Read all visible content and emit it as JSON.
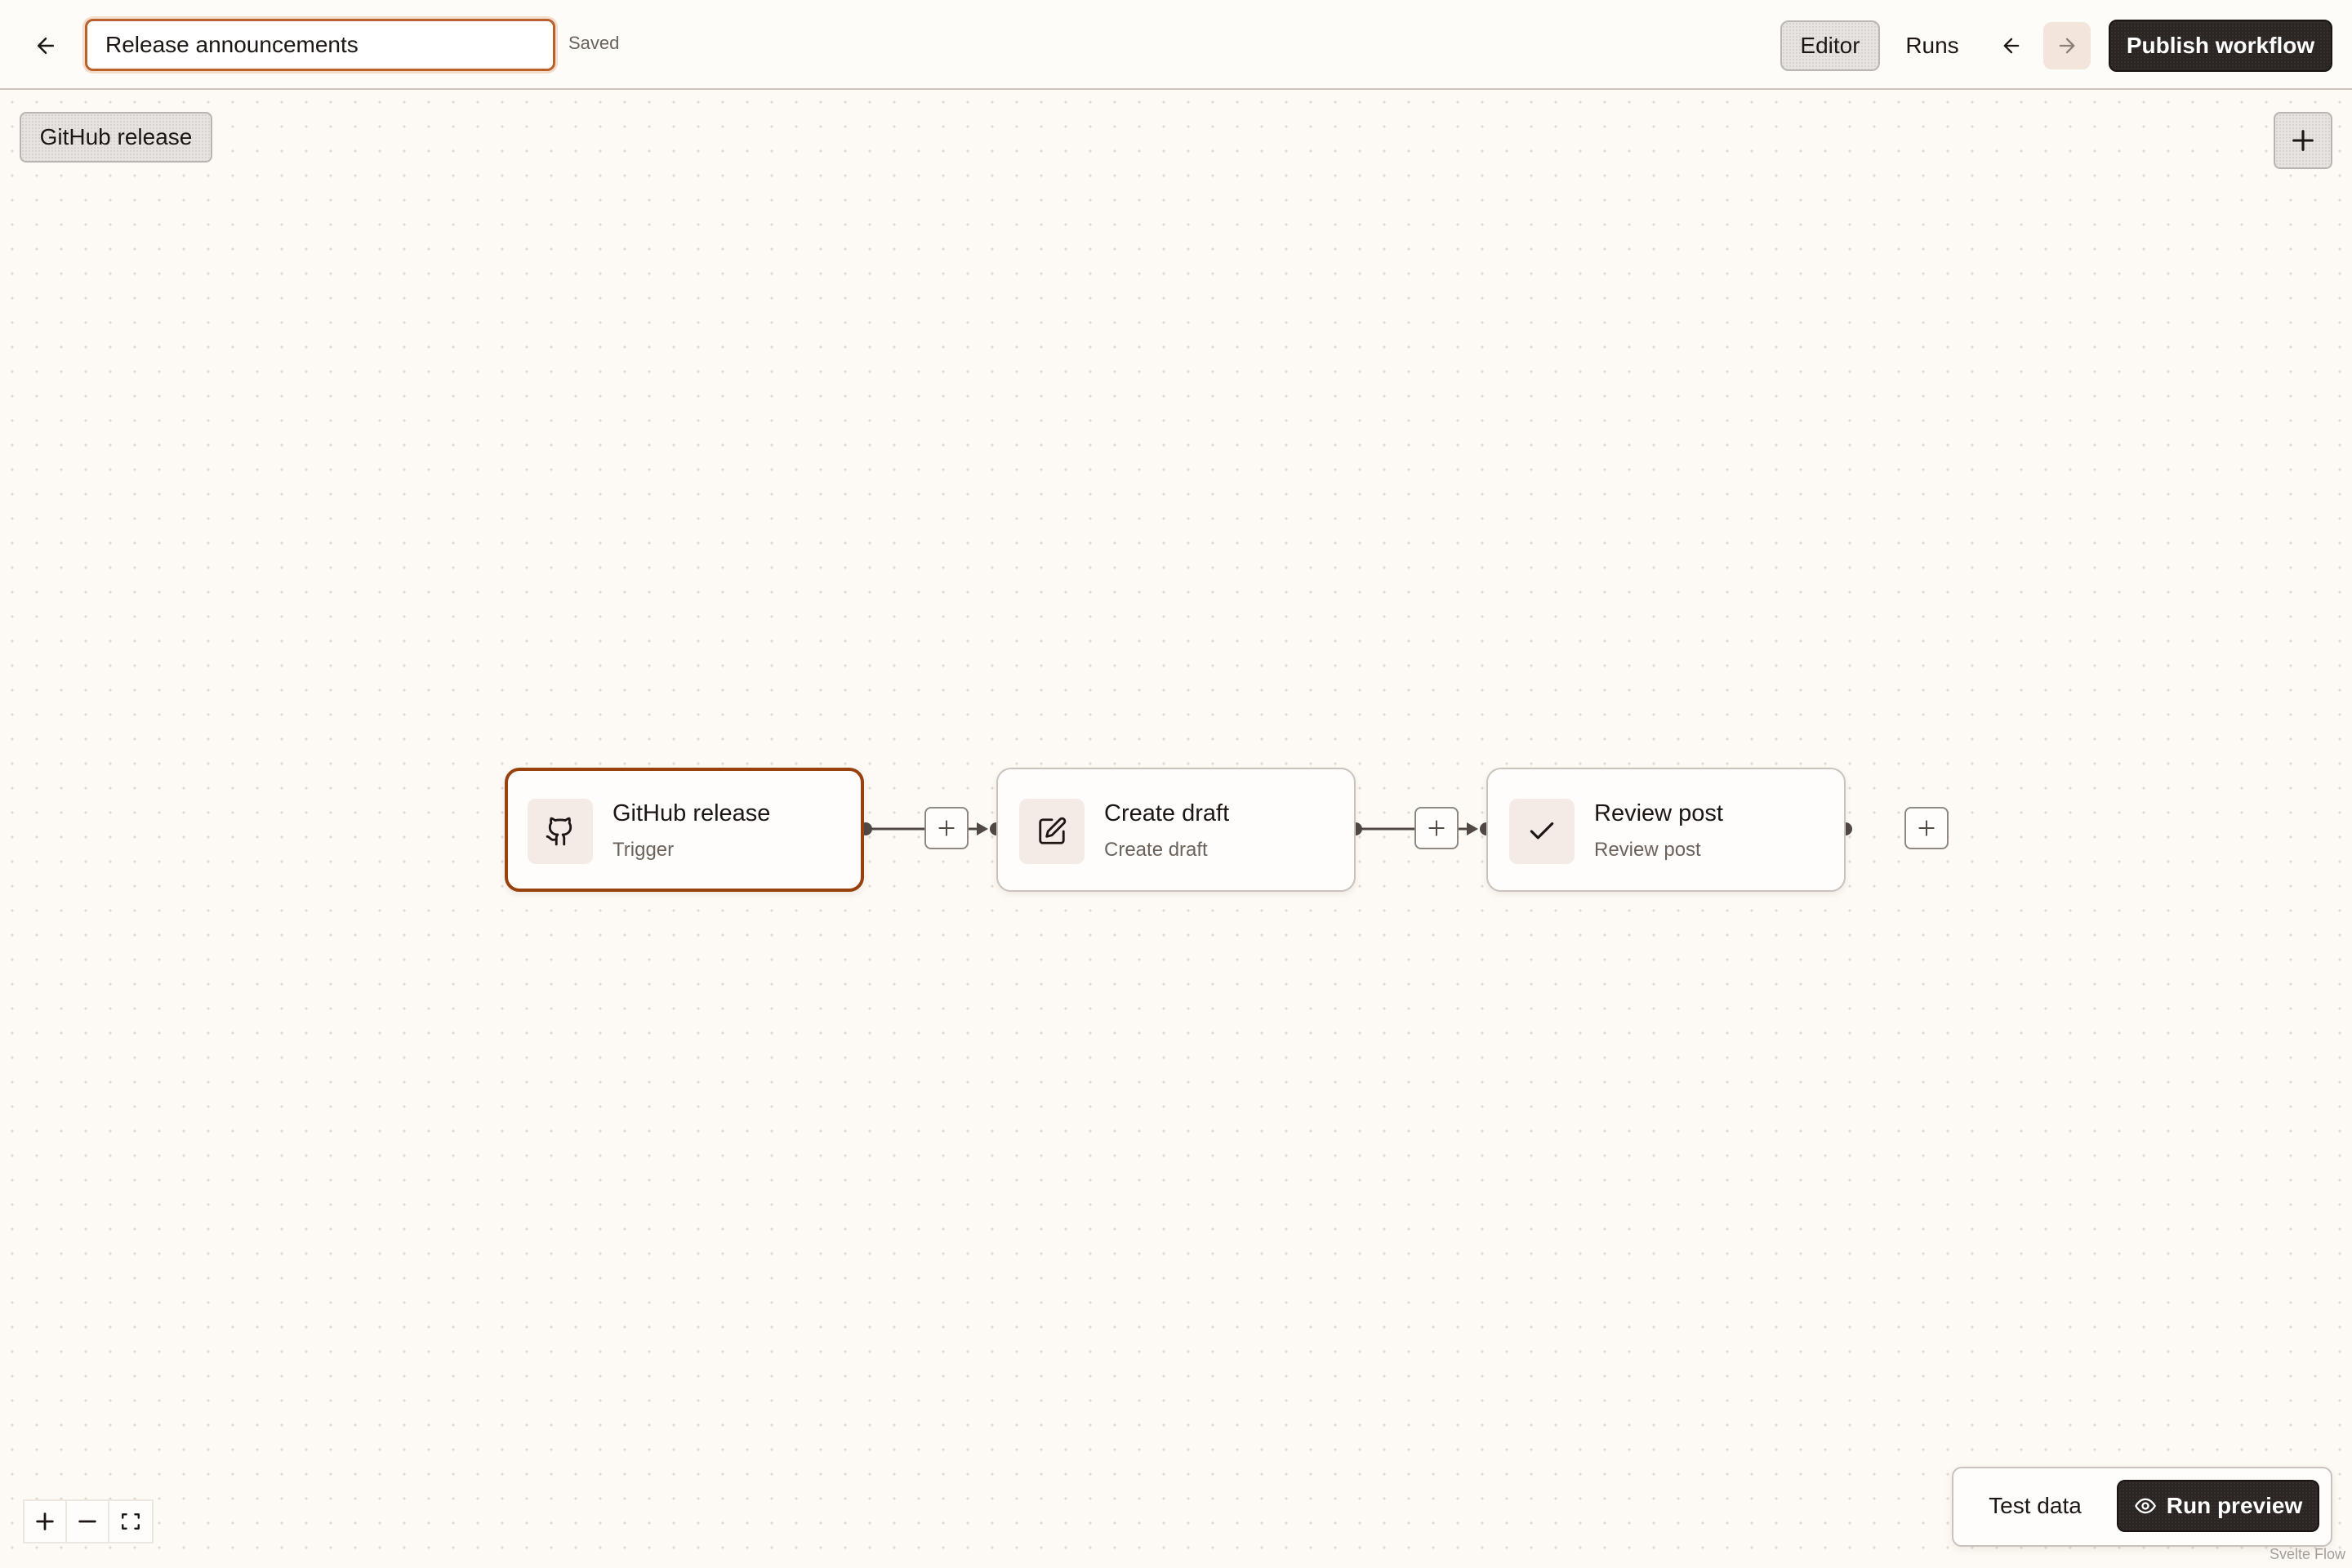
{
  "header": {
    "back_icon": "arrow-left-icon",
    "workflow_name": "Release announcements",
    "save_status": "Saved",
    "tabs": [
      {
        "label": "Editor",
        "active": true
      },
      {
        "label": "Runs",
        "active": false
      }
    ],
    "undo_icon": "arrow-left-icon",
    "redo_icon": "arrow-right-icon",
    "publish_label": "Publish workflow"
  },
  "canvas": {
    "trigger_chip_label": "GitHub release",
    "add_node_icon": "plus-icon",
    "nodes": [
      {
        "title": "GitHub release",
        "subtitle": "Trigger",
        "icon": "github-icon",
        "selected": true
      },
      {
        "title": "Create draft",
        "subtitle": "Create draft",
        "icon": "edit-icon",
        "selected": false
      },
      {
        "title": "Review post",
        "subtitle": "Review post",
        "icon": "check-icon",
        "selected": false
      }
    ],
    "edge_add_icon": "plus-icon"
  },
  "zoom_controls": {
    "zoom_in_icon": "plus-icon",
    "zoom_out_icon": "minus-icon",
    "fit_view_icon": "fit-view-icon"
  },
  "preview_panel": {
    "test_data_label": "Test data",
    "run_preview_label": "Run preview",
    "run_preview_icon": "eye-icon"
  },
  "attribution": "Svelte Flow",
  "colors": {
    "accent_border": "#98410f",
    "input_focus": "#b8612e",
    "dark_button": "#2b2523",
    "canvas_bg": "#fdf9f4"
  }
}
